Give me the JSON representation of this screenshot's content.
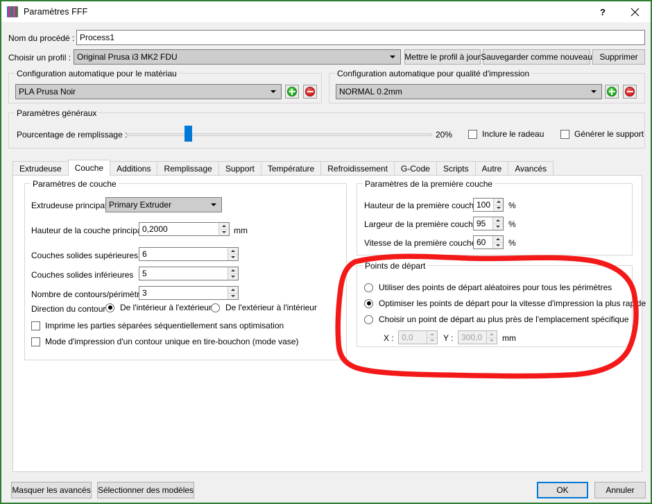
{
  "window": {
    "title": "Paramètres FFF",
    "icon": "app-stripes-icon",
    "help_glyph": "?",
    "close_glyph": "✕",
    "border_color": "#2e7d32"
  },
  "top": {
    "process_name_label": "Nom du procédé :",
    "process_name_value": "Process1",
    "profile_label": "Choisir un profil :",
    "profile_value": "Original Prusa i3 MK2 FDU",
    "update_profile_button": "Mettre le profil à jour",
    "save_as_new_button": "Sauvegarder comme nouveau",
    "delete_button": "Supprimer"
  },
  "material_group": {
    "title": "Configuration automatique pour le matériau",
    "value": "PLA Prusa Noir",
    "add_button": "+",
    "remove_button": "−"
  },
  "quality_group": {
    "title": "Configuration automatique pour qualité d'impression",
    "value": "NORMAL 0.2mm",
    "add_button": "+",
    "remove_button": "−"
  },
  "general_group": {
    "title": "Paramètres généraux",
    "infill_label": "Pourcentage de remplissage :",
    "infill_value": "20%",
    "infill_percent": 20,
    "raft_checkbox": "Inclure le radeau",
    "raft_checked": false,
    "support_checkbox": "Générer le support",
    "support_checked": false
  },
  "tabs": [
    {
      "label": "Extrudeuse",
      "active": false
    },
    {
      "label": "Couche",
      "active": true
    },
    {
      "label": "Additions",
      "active": false
    },
    {
      "label": "Remplissage",
      "active": false
    },
    {
      "label": "Support",
      "active": false
    },
    {
      "label": "Température",
      "active": false
    },
    {
      "label": "Refroidissement",
      "active": false
    },
    {
      "label": "G-Code",
      "active": false
    },
    {
      "label": "Scripts",
      "active": false
    },
    {
      "label": "Autre",
      "active": false
    },
    {
      "label": "Avancés",
      "active": false
    }
  ],
  "layer_group": {
    "title": "Paramètres de couche",
    "primary_extruder_label": "Extrudeuse principale",
    "primary_extruder_value": "Primary Extruder",
    "layer_height_label": "Hauteur de la couche principale",
    "layer_height_value": "0,2000",
    "layer_height_unit": "mm",
    "top_solid_label": "Couches solides supérieures",
    "top_solid_value": "6",
    "bottom_solid_label": "Couches solides inférieures",
    "bottom_solid_value": "5",
    "perimeter_label": "Nombre de contours/périmètres",
    "perimeter_value": "3",
    "outline_direction_label": "Direction du contour :",
    "outline_inside_out": "De l'intérieur à l'extérieur",
    "outline_inside_out_selected": true,
    "outline_outside_in": "De l'extérieur à l'intérieur",
    "outline_outside_in_selected": false,
    "sequential_checkbox": "Imprime les parties séparées séquentiellement sans optimisation",
    "sequential_checked": false,
    "vase_checkbox": "Mode d'impression d'un contour unique en tire-bouchon (mode vase)",
    "vase_checked": false
  },
  "first_layer_group": {
    "title": "Paramètres de la première couche",
    "height_label": "Hauteur de la première couche",
    "height_value": "100",
    "height_unit": "%",
    "width_label": "Largeur de la première couche",
    "width_value": "95",
    "width_unit": "%",
    "speed_label": "Vitesse de la première couche",
    "speed_value": "60",
    "speed_unit": "%"
  },
  "start_points_group": {
    "title": "Points de départ",
    "random_label": "Utiliser des points de départ aléatoires pour tous les périmètres",
    "random_selected": false,
    "optimize_label": "Optimiser les points de départ pour la vitesse d'impression la plus rapide",
    "optimize_selected": true,
    "specific_label": "Choisir un point de départ au plus près de l'emplacement spécifique",
    "specific_selected": false,
    "x_label": "X :",
    "x_value": "0,0",
    "y_label": "Y :",
    "y_value": "300,0",
    "unit": "mm"
  },
  "footer": {
    "hide_advanced_button": "Masquer les avancés",
    "select_models_button": "Sélectionner des modèles",
    "ok_button": "OK",
    "cancel_button": "Annuler",
    "ok_focus_color": "#0078d7"
  },
  "annotation": {
    "type": "hand-drawn-ellipse",
    "color": "#f41919",
    "target": "start_points_group"
  }
}
